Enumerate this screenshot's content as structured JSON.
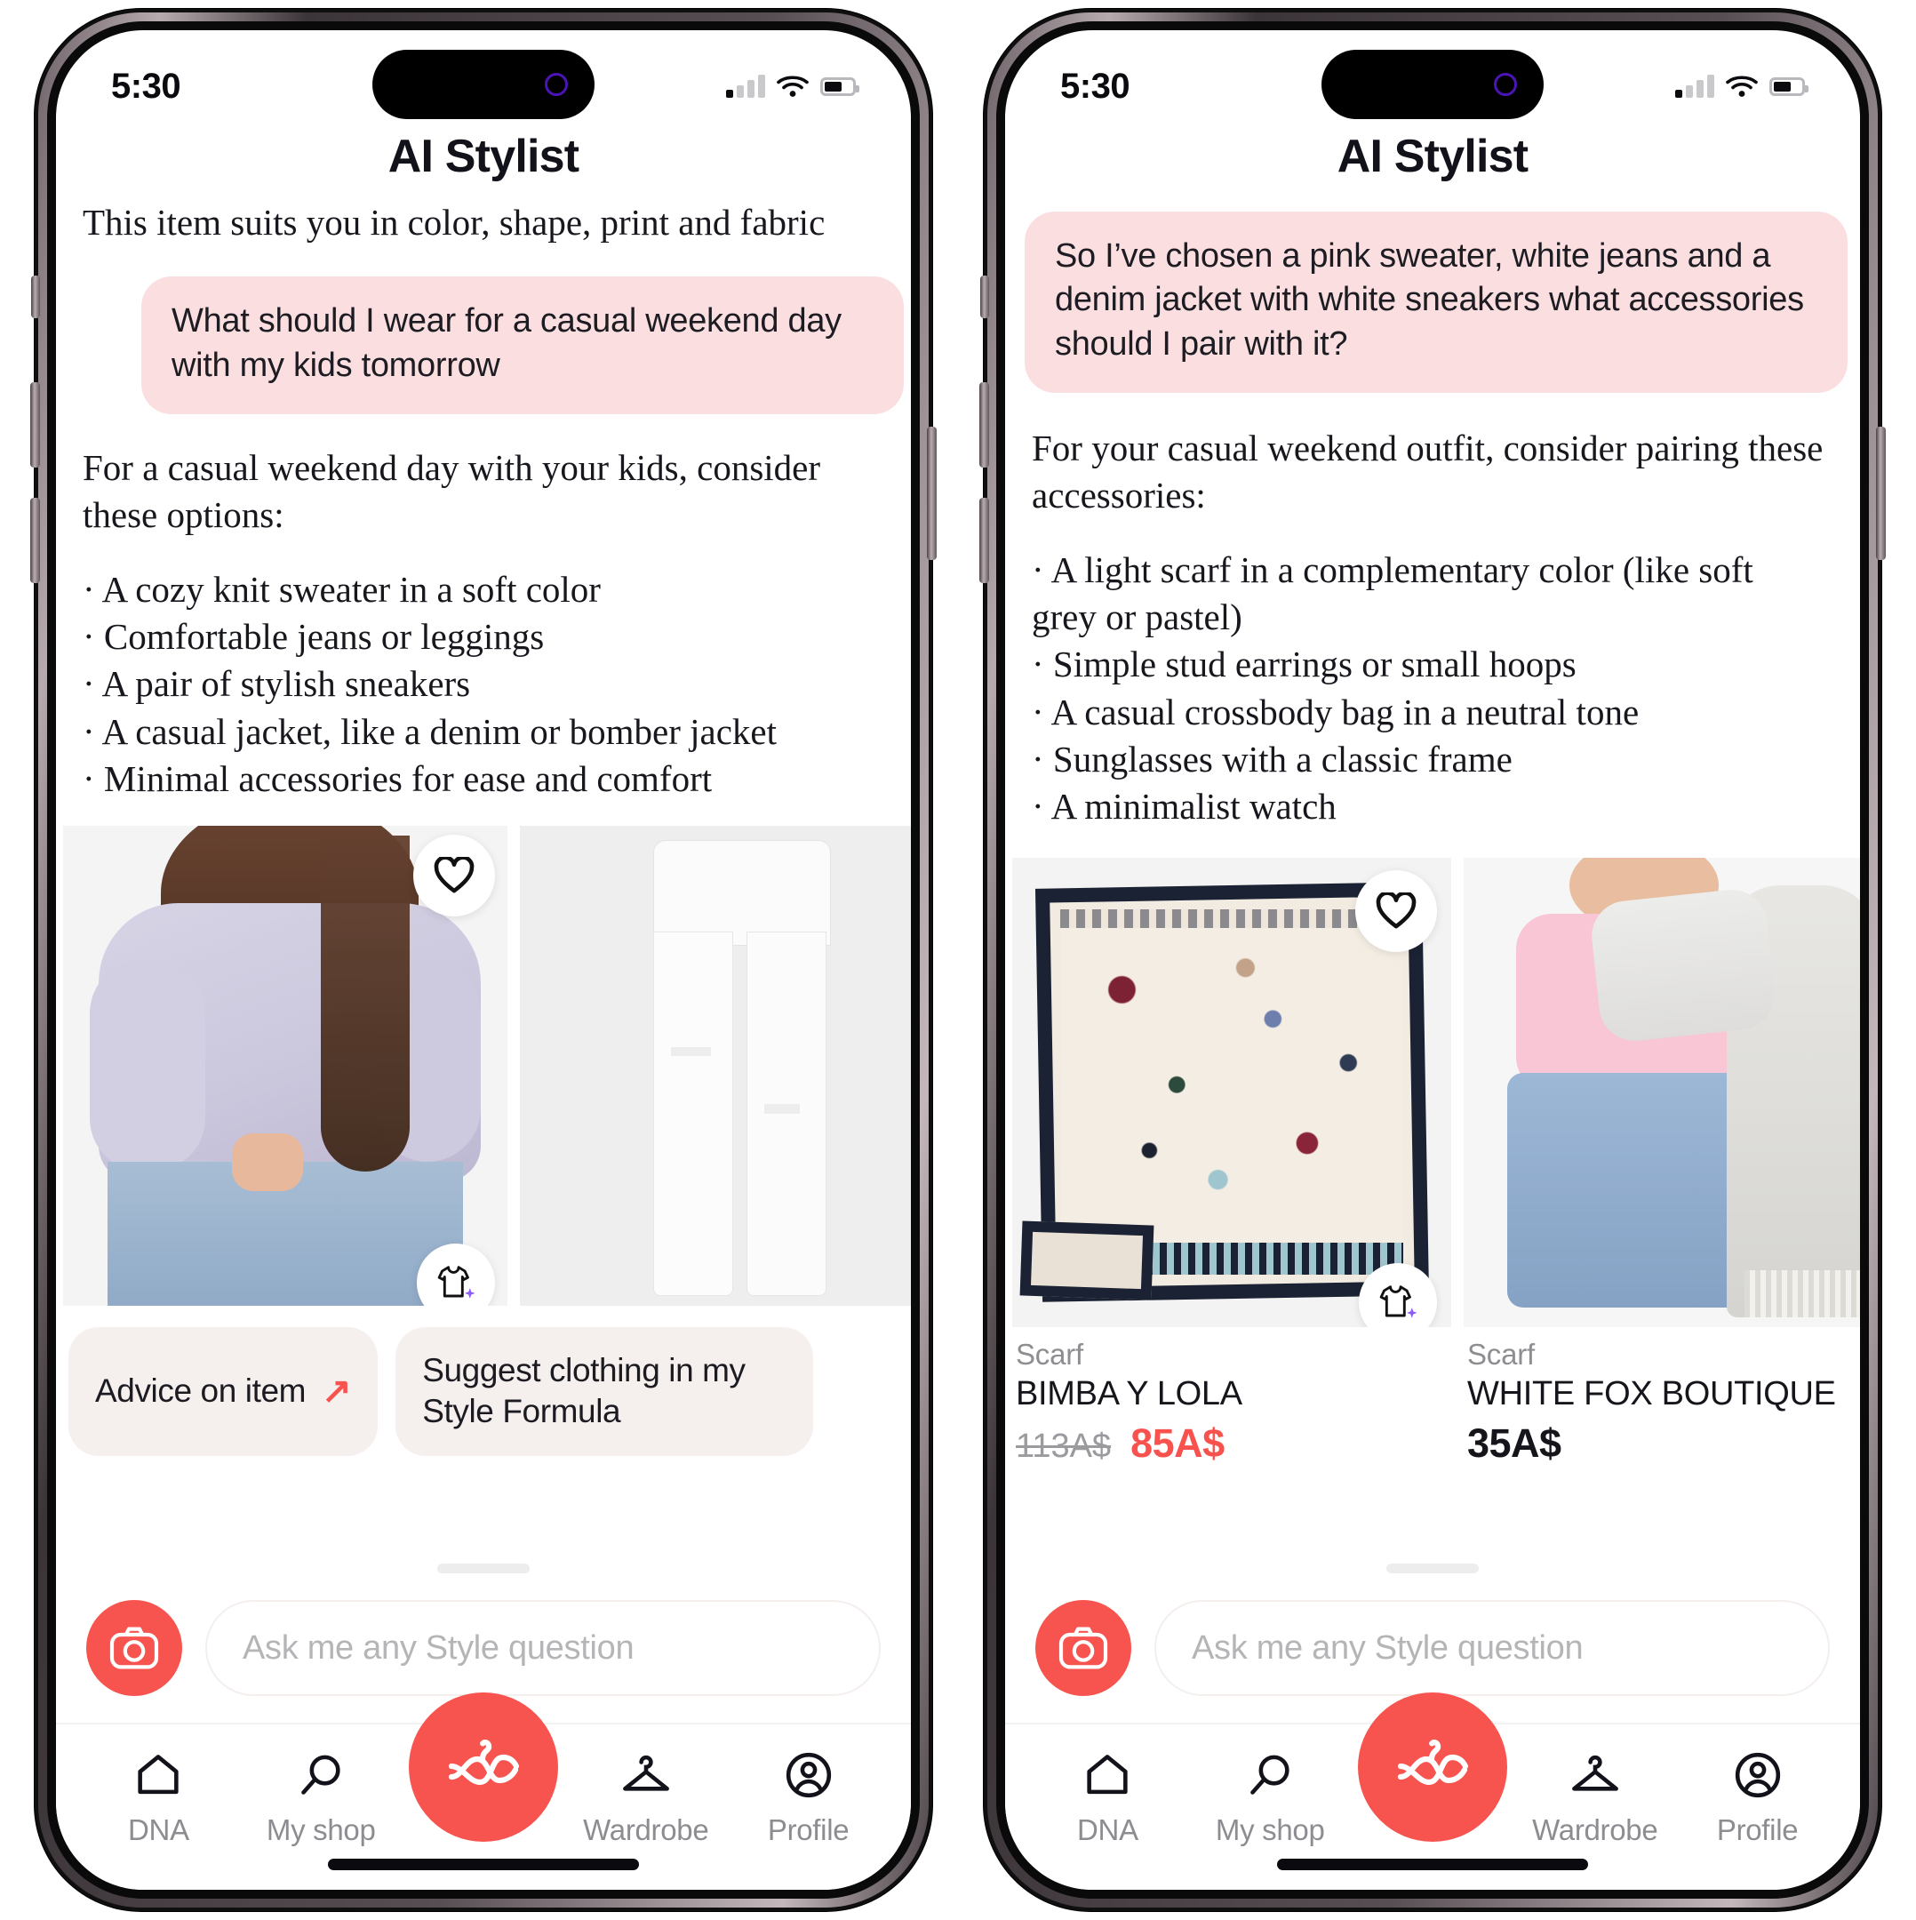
{
  "accent": "#f8544f",
  "bubble_bg": "#fbdfe0",
  "chip_bg": "#f5f0ee",
  "sale_price_color": "#f8524f",
  "sparkle_color": "#8b5cf6",
  "status": {
    "time": "5:30",
    "signal_icon": "signal-bars-icon",
    "wifi_icon": "wifi-icon",
    "battery_icon": "battery-icon"
  },
  "header": {
    "title": "AI Stylist"
  },
  "composer": {
    "placeholder": "Ask me any Style question",
    "camera_icon": "camera-icon"
  },
  "tabs": [
    {
      "label": "DNA",
      "icon": "home-icon"
    },
    {
      "label": "My shop",
      "icon": "search-icon"
    },
    {
      "label": "",
      "icon": "stylist-knot-icon"
    },
    {
      "label": "Wardrobe",
      "icon": "hanger-icon"
    },
    {
      "label": "Profile",
      "icon": "person-circle-icon"
    }
  ],
  "screen_left": {
    "intro_note": "This item suits you in color, shape, print and fabric",
    "user_message": "What should I wear for a casual weekend day with my kids tomorrow",
    "ai_intro": "For a casual weekend day with your kids, consider these options:",
    "ai_bullets": [
      "· A cozy knit sweater in a soft color",
      "· Comfortable jeans or leggings",
      "· A pair of stylish sneakers",
      "· A casual jacket, like a denim or bomber jacket",
      "· Minimal accessories for ease and comfort"
    ],
    "products": [
      {
        "alt": "lilac knit sweater on model",
        "heart_icon": "heart-icon",
        "tee_icon": "tshirt-sparkle-icon"
      },
      {
        "alt": "white ripped jeans",
        "heart_icon": "",
        "tee_icon": ""
      }
    ],
    "chips": [
      {
        "label": "Advice on item",
        "arrow": "↗"
      },
      {
        "label": "Suggest clothing in my Style Formula",
        "arrow": ""
      }
    ]
  },
  "screen_right": {
    "user_message": "So I’ve chosen a pink sweater, white jeans and a denim jacket with white sneakers  what accessories should I pair with it?",
    "ai_intro": "For your casual weekend outfit, consider pairing these accessories:",
    "ai_bullets": [
      "· A light scarf in a complementary color (like soft",
      "grey or pastel)",
      "· Simple stud earrings or small hoops",
      "· A casual crossbody bag in a neutral tone",
      "· Sunglasses with a classic frame",
      "· A minimalist watch"
    ],
    "products": [
      {
        "category": "Scarf",
        "brand": "BIMBA Y LOLA",
        "old_price": "113A$",
        "price": "85A$",
        "heart_icon": "heart-icon",
        "tee_icon": "tshirt-sparkle-icon"
      },
      {
        "category": "Scarf",
        "brand": "WHITE FOX BOUTIQUE",
        "old_price": "",
        "price": "35A$",
        "heart_icon": "",
        "tee_icon": ""
      }
    ]
  }
}
